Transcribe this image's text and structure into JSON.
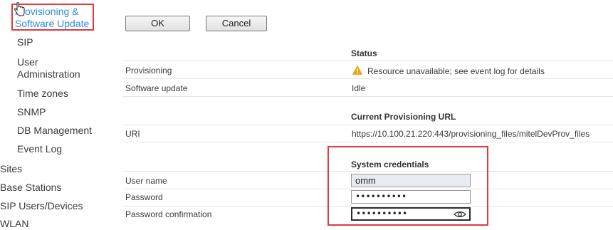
{
  "sidebar": {
    "active_item": "Provisioning & Software Update",
    "items": [
      "SIP",
      "User Administration",
      "Time zones",
      "SNMP",
      "DB Management",
      "Event Log"
    ],
    "top_items": [
      "Sites",
      "Base Stations",
      "SIP Users/Devices",
      "WLAN"
    ]
  },
  "buttons": {
    "ok": "OK",
    "cancel": "Cancel"
  },
  "status": {
    "header": "Status",
    "provisioning_label": "Provisioning",
    "provisioning_value": "Resource unavailable; see event log for details",
    "software_label": "Software update",
    "software_value": "Idle"
  },
  "provisioning_url": {
    "header": "Current Provisioning URL",
    "uri_label": "URI",
    "uri_value": "https://10.100.21.220:443/provisioning_files/mitelDevProv_files"
  },
  "credentials": {
    "header": "System credentials",
    "username_label": "User name",
    "username_value": "omm",
    "password_label": "Password",
    "password_value": "••••••••••",
    "confirm_label": "Password confirmation",
    "confirm_value": "••••••••••"
  },
  "colors": {
    "highlight": "#e03a3a",
    "link": "#2f8fd8",
    "warning": "#f0a800"
  }
}
